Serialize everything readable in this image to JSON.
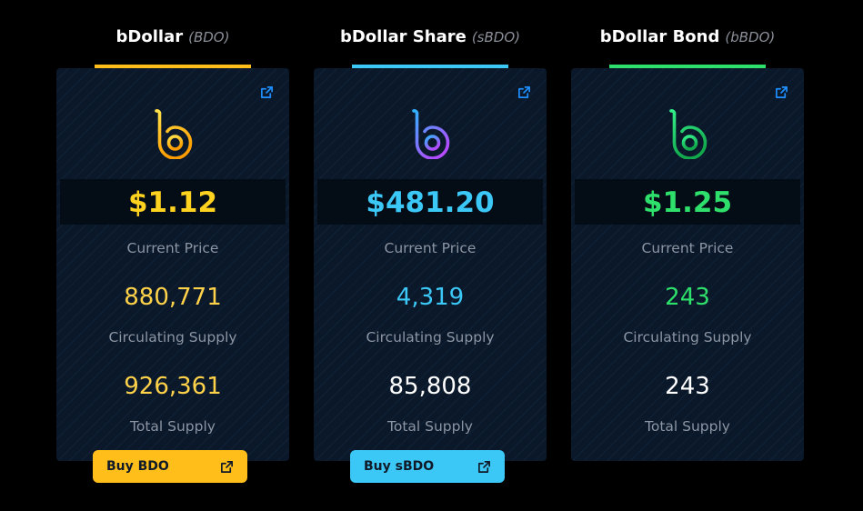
{
  "tokens": [
    {
      "name": "bDollar",
      "symbol": "(BDO)",
      "accent": "#ffbe1a",
      "price": "$1.12",
      "price_label": "Current Price",
      "circulating_supply": "880,771",
      "circulating_label": "Circulating Supply",
      "total_supply": "926,361",
      "total_label": "Total Supply",
      "buy_label": "Buy BDO",
      "logo_colors": [
        "#ffe14a",
        "#ff9d00"
      ],
      "total_color": "#ffd24a",
      "icons": {
        "external": "external-link-icon",
        "logo": "bdollar-logo-icon"
      }
    },
    {
      "name": "bDollar Share",
      "symbol": "(sBDO)",
      "accent": "#3cc8f7",
      "price": "$481.20",
      "price_label": "Current Price",
      "circulating_supply": "4,319",
      "circulating_label": "Circulating Supply",
      "total_supply": "85,808",
      "total_label": "Total Supply",
      "buy_label": "Buy sBDO",
      "logo_colors": [
        "#2fb3ff",
        "#b34bff"
      ],
      "total_color": "#ffffff",
      "icons": {
        "external": "external-link-icon",
        "logo": "bdollar-share-logo-icon"
      }
    },
    {
      "name": "bDollar Bond",
      "symbol": "(bBDO)",
      "accent": "#2ee06b",
      "price": "$1.25",
      "price_label": "Current Price",
      "circulating_supply": "243",
      "circulating_label": "Circulating Supply",
      "total_supply": "243",
      "total_label": "Total Supply",
      "logo_colors": [
        "#35f08a",
        "#12a84c"
      ],
      "total_color": "#ffffff",
      "icons": {
        "external": "external-link-icon",
        "logo": "bdollar-bond-logo-icon"
      }
    }
  ],
  "external_icon_color": "#1f8fff"
}
